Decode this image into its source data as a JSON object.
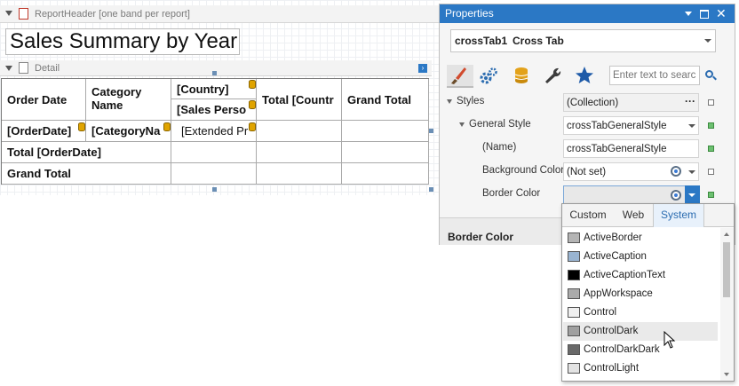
{
  "designer": {
    "report_header_caption": "ReportHeader [one band per report]",
    "title_text": "Sales Summary by Year",
    "detail_caption": "Detail",
    "crosstab": {
      "header_row": {
        "order_date": "Order Date",
        "category_name": "Category Name",
        "country": "[Country]",
        "total_country": "Total [Countr",
        "grand_total": "Grand Total",
        "sales_person": "[Sales Perso"
      },
      "data_row": {
        "order_date": "[OrderDate]",
        "category_name": "[CategoryNa",
        "extended_price": "[Extended Pr"
      },
      "total_row": "Total [OrderDate]",
      "grand_total_row": "Grand Total"
    }
  },
  "properties": {
    "title": "Properties",
    "selected_object": "crossTab1",
    "selected_type": "Cross Tab",
    "search_placeholder": "Enter text to search...",
    "toolbar_icons": [
      "brush-icon",
      "gears-icon",
      "database-icon",
      "wrench-icon",
      "star-icon"
    ],
    "rows": [
      {
        "label": "Styles",
        "value": "(Collection)"
      },
      {
        "label": "General Style",
        "value": "crossTabGeneralStyle"
      },
      {
        "label": "(Name)",
        "value": "crossTabGeneralStyle"
      },
      {
        "label": "Background Color",
        "value": "(Not set)"
      },
      {
        "label": "Border Color",
        "value": ""
      }
    ],
    "styles_ellipsis": "···",
    "description_title": "Border Color"
  },
  "color_popup": {
    "tabs": [
      "Custom",
      "Web",
      "System"
    ],
    "active_tab": "System",
    "colors": [
      {
        "name": "ActiveBorder",
        "hex": "#b4b4b4"
      },
      {
        "name": "ActiveCaption",
        "hex": "#99b4d1"
      },
      {
        "name": "ActiveCaptionText",
        "hex": "#000000"
      },
      {
        "name": "AppWorkspace",
        "hex": "#ababab"
      },
      {
        "name": "Control",
        "hex": "#f0f0f0"
      },
      {
        "name": "ControlDark",
        "hex": "#a0a0a0"
      },
      {
        "name": "ControlDarkDark",
        "hex": "#696969"
      },
      {
        "name": "ControlLight",
        "hex": "#e3e3e3"
      }
    ],
    "hovered": "ControlDark"
  },
  "colors": {
    "accent": "#2b78c5",
    "active_square": "#4caf50"
  }
}
